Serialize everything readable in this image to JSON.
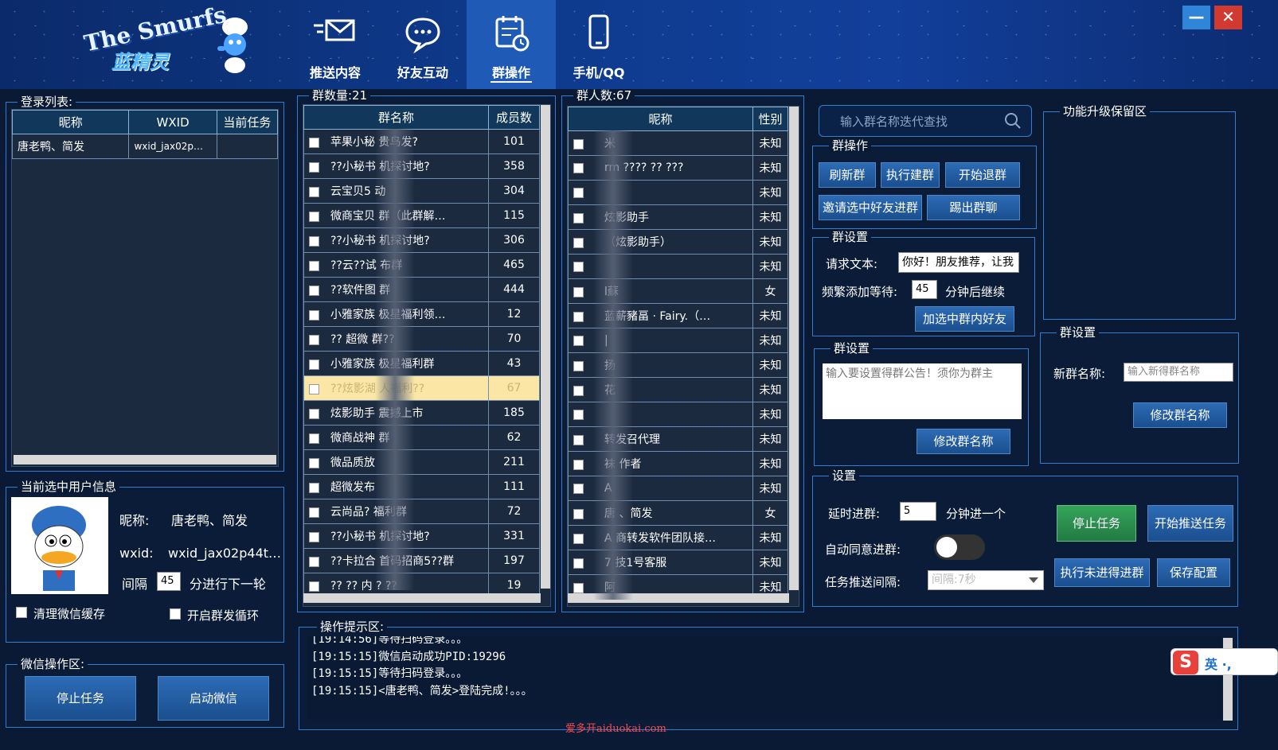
{
  "app": {
    "logo_text": "The Smurfs",
    "logo_cn": "蓝精灵"
  },
  "nav": [
    {
      "label": "推送内容",
      "icon": "send-mail-icon"
    },
    {
      "label": "好友互动",
      "icon": "chat-bubble-icon"
    },
    {
      "label": "群操作",
      "icon": "calendar-clock-icon"
    },
    {
      "label": "手机/QQ",
      "icon": "phone-icon"
    }
  ],
  "window": {
    "minimize": "—",
    "close": "✕"
  },
  "login_list": {
    "title": "登录列表:",
    "columns": [
      "昵称",
      "WXID",
      "当前任务"
    ],
    "rows": [
      {
        "nick": "唐老鸭、简发",
        "wxid": "wxid_jax02p…",
        "task": ""
      }
    ]
  },
  "current_user": {
    "title": "当前选中用户信息",
    "nick_label": "昵称:",
    "nick": "唐老鸭、简发",
    "wxid_label": "wxid:",
    "wxid": "wxid_jax02p44t…",
    "interval_label": "间隔",
    "interval_value": "45",
    "interval_suffix": "分进行下一轮",
    "clear_cache": "清理微信缓存",
    "loop_group": "开启群发循环"
  },
  "wechat_ops": {
    "title": "微信操作区:",
    "stop": "停止任务",
    "start": "启动微信"
  },
  "groups": {
    "title": "群数量:21",
    "columns": [
      "群名称",
      "成员数"
    ],
    "rows": [
      {
        "name": "苹果小秘 贵鸟发?",
        "count": "101"
      },
      {
        "name": "??小秘书 机探讨地?",
        "count": "358"
      },
      {
        "name": "云宝贝5 动",
        "count": "304"
      },
      {
        "name": "微商宝贝 群（此群解…",
        "count": "115"
      },
      {
        "name": "??小秘书 机探讨地?",
        "count": "306"
      },
      {
        "name": "??云??试 布群",
        "count": "465"
      },
      {
        "name": "??软件图 群",
        "count": "444"
      },
      {
        "name": "小雅家族 极星福利领…",
        "count": "12"
      },
      {
        "name": "?? 超微 群??",
        "count": "70"
      },
      {
        "name": "小雅家族 极星福利群",
        "count": "43"
      },
      {
        "name": "??炫影湖 人福利??",
        "count": "67"
      },
      {
        "name": "炫影助手 震撼上市",
        "count": "185"
      },
      {
        "name": "微商战神 群",
        "count": "62"
      },
      {
        "name": "微品质放",
        "count": "211"
      },
      {
        "name": "超微发布",
        "count": "111"
      },
      {
        "name": "云尚品? 福利群",
        "count": "72"
      },
      {
        "name": "??小秘书 机探讨地?",
        "count": "331"
      },
      {
        "name": "??卡拉合 首码招商5??群",
        "count": "197"
      },
      {
        "name": "?? ?? 内 ? ??",
        "count": "19"
      }
    ],
    "selected_index": 10
  },
  "members": {
    "title": "群人数:67",
    "columns": [
      "昵称",
      "性别"
    ],
    "rows": [
      {
        "name": "米",
        "sex": "未知"
      },
      {
        "name": "rm ???? ?? ???",
        "sex": "未知"
      },
      {
        "name": "",
        "sex": "未知"
      },
      {
        "name": "炫影助手",
        "sex": "未知"
      },
      {
        "name": "（炫影助手）",
        "sex": "未知"
      },
      {
        "name": "",
        "sex": "未知"
      },
      {
        "name": "l蘇",
        "sex": "女"
      },
      {
        "name": "蓝薪豬畐 · Fairy.（…",
        "sex": "未知"
      },
      {
        "name": "|",
        "sex": "未知"
      },
      {
        "name": "扬",
        "sex": "未知"
      },
      {
        "name": "花",
        "sex": "未知"
      },
      {
        "name": "",
        "sex": "未知"
      },
      {
        "name": "转发召代理",
        "sex": "未知"
      },
      {
        "name": "袜 作者",
        "sex": "未知"
      },
      {
        "name": "A",
        "sex": "未知"
      },
      {
        "name": "唐 、简发",
        "sex": "女"
      },
      {
        "name": "A 商转发软件团队接…",
        "sex": "未知"
      },
      {
        "name": "7 技1号客服",
        "sex": "未知"
      },
      {
        "name": "阿",
        "sex": "未知"
      }
    ]
  },
  "search": {
    "placeholder": "输入群名称迭代查找"
  },
  "group_ops": {
    "title": "群操作",
    "refresh": "刷新群",
    "build": "执行建群",
    "quit": "开始退群",
    "invite": "邀请选中好友进群",
    "kick": "踢出群聊"
  },
  "group_settings1": {
    "title": "群设置",
    "req_label": "请求文本:",
    "req_value": "你好！朋友推荐，让我",
    "freq_label": "频繁添加等待:",
    "freq_value": "45",
    "freq_suffix": "分钟后继续",
    "add_btn": "加选中群内好友"
  },
  "group_settings2": {
    "title": "群设置",
    "notice_placeholder": "输入要设置得群公告！须你为群主",
    "btn": "修改群名称"
  },
  "upgrade": {
    "title": "功能升级保留区"
  },
  "group_settings3": {
    "title": "群设置",
    "name_label": "新群名称:",
    "name_placeholder": "输入新得群名称",
    "btn": "修改群名称"
  },
  "settings": {
    "title": "设置",
    "delay_label": "延时进群:",
    "delay_value": "5",
    "delay_suffix": "分钟进一个",
    "auto_label": "自动同意进群:",
    "interval_label": "任务推送间隔:",
    "interval_value": "间隔:7秒",
    "stop": "停止任务",
    "start_push": "开始推送任务",
    "exec_join": "执行未进得进群",
    "save": "保存配置"
  },
  "log": {
    "title": "操作提示区:",
    "lines": [
      "[19:14:56]等待扫码登录。。。",
      "[19:15:15]微信启动成功PID:19296",
      "[19:15:15]等待扫码登录。。。",
      "[19:15:15]<唐老鸭、简发>登陆完成!。。。"
    ]
  },
  "ime": {
    "text": "英 ·,"
  },
  "watermark": "爱多开aiduokai.com"
}
